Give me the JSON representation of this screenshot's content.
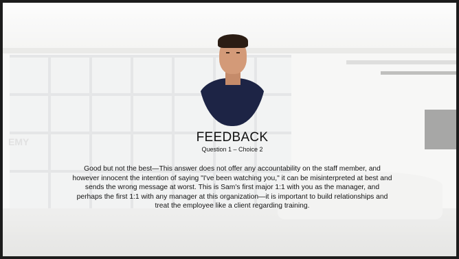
{
  "slide": {
    "title": "FEEDBACK",
    "subtitle": "Question 1 – Choice 2",
    "body": "Good but not the best—This answer does not offer any accountability on the staff member, and however innocent the intention of saying \"I've been watching you,\" it can be misinterpreted at best and sends the wrong message at worst.  This is Sam's first major 1:1 with you as the manager, and perhaps the first 1:1 with any manager at this organization—it is important to build relationships and treat the employee like a client regarding training.",
    "background_sign_text": "EMY"
  },
  "colors": {
    "text": "#111111",
    "frame": "#1c1c1c",
    "shirt": "#1d2445"
  }
}
